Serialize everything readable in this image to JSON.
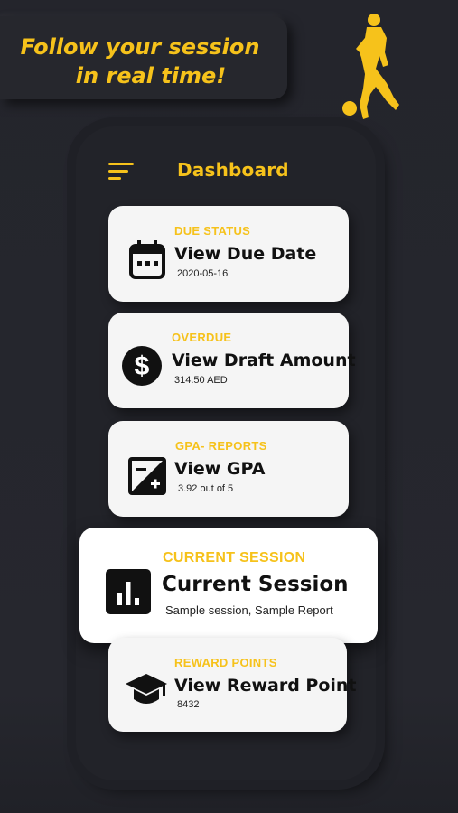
{
  "banner": {
    "line1": "Follow your session",
    "line2": "in real time!"
  },
  "header": {
    "title": "Dashboard"
  },
  "cards": [
    {
      "category": "DUE STATUS",
      "title": "View Due Date",
      "subtitle": "2020-05-16",
      "icon": "calendar-icon"
    },
    {
      "category": "OVERDUE",
      "title": "View Draft Amount",
      "subtitle": "314.50 AED",
      "icon": "dollar-icon"
    },
    {
      "category": "GPA- REPORTS",
      "title": "View GPA",
      "subtitle": "3.92 out of 5",
      "icon": "exposure-icon"
    },
    {
      "category": "CURRENT SESSION",
      "title": "Current Session",
      "subtitle": "Sample session, Sample Report",
      "icon": "bar-chart-icon"
    },
    {
      "category": "REWARD POINTS",
      "title": "View Reward Point",
      "subtitle": "8432",
      "icon": "graduation-cap-icon"
    }
  ],
  "colors": {
    "accent": "#f6c21b",
    "background": "#24252c",
    "card": "#f5f5f5"
  }
}
